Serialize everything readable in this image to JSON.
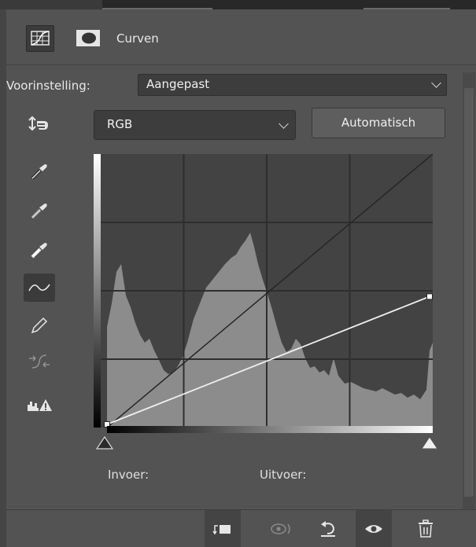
{
  "panel": {
    "title": "Curven",
    "icon_names": [
      "curves-adjustment-icon",
      "layer-mask-icon"
    ]
  },
  "preset": {
    "label": "Voorinstelling:",
    "value": "Aangepast"
  },
  "channel": {
    "value": "RGB"
  },
  "auto_button": "Automatisch",
  "tools": [
    {
      "name": "on-image-adjust-icon",
      "active": false
    },
    {
      "name": "black-point-eyedropper-icon",
      "active": false
    },
    {
      "name": "gray-point-eyedropper-icon",
      "active": false
    },
    {
      "name": "white-point-eyedropper-icon",
      "active": false
    },
    {
      "name": "curve-points-icon",
      "active": true
    },
    {
      "name": "pencil-icon",
      "active": false
    },
    {
      "name": "smooth-curve-icon",
      "active": false
    },
    {
      "name": "clipping-warning-icon",
      "active": false
    }
  ],
  "curve": {
    "points": [
      {
        "input": 0,
        "output": 0
      },
      {
        "input": 255,
        "output": 122
      }
    ],
    "range": [
      0,
      255
    ]
  },
  "readout": {
    "input_label": "Invoer:",
    "output_label": "Uitvoer:"
  },
  "footer_icons": [
    "clip-to-layer-icon",
    "view-previous-state-icon",
    "reset-icon",
    "visibility-eye-icon",
    "delete-trash-icon"
  ],
  "colors": {
    "panel_bg": "#535353",
    "graph_bg": "#434343",
    "histogram": "#8c8c8c",
    "curve": "#f0f0f0"
  }
}
